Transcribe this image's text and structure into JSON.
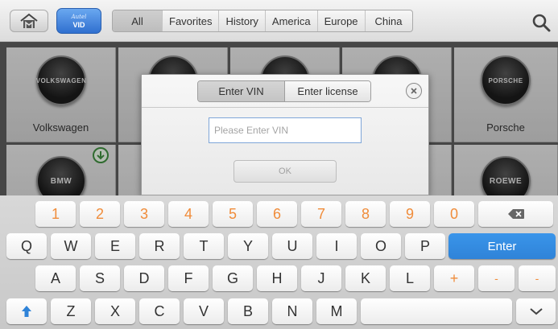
{
  "toolbar": {
    "vid_brand": "Autel",
    "vid_label": "VID",
    "tabs": [
      "All",
      "Favorites",
      "History",
      "America",
      "Europe",
      "China"
    ]
  },
  "brands": [
    {
      "logo_text": "VOLKSWAGEN",
      "name": "Volkswagen"
    },
    {
      "logo_text": "PORSCHE",
      "name": "Porsche"
    },
    {
      "logo_text": "BMW",
      "name": ""
    },
    {
      "logo_text": "ROEWE",
      "name": ""
    }
  ],
  "dialog": {
    "tab_vin": "Enter VIN",
    "tab_license": "Enter license",
    "vin_placeholder": "Please Enter VIN",
    "ok_label": "OK"
  },
  "keyboard": {
    "row1": [
      "1",
      "2",
      "3",
      "4",
      "5",
      "6",
      "7",
      "8",
      "9",
      "0"
    ],
    "row2": [
      "Q",
      "W",
      "E",
      "R",
      "T",
      "Y",
      "U",
      "I",
      "O",
      "P"
    ],
    "enter_label": "Enter",
    "row3": [
      "A",
      "S",
      "D",
      "F",
      "G",
      "H",
      "J",
      "K",
      "L"
    ],
    "plus": "+",
    "minus1": "-",
    "minus2": "-",
    "row4": [
      "Z",
      "X",
      "C",
      "V",
      "B",
      "N",
      "M"
    ]
  },
  "colors": {
    "accent_blue": "#2f83d8",
    "number_orange": "#f08c3a",
    "download_green": "#3e8a3e"
  }
}
